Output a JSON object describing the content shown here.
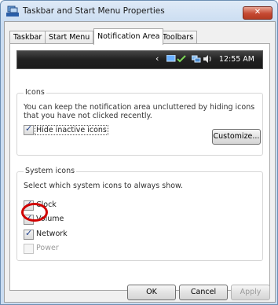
{
  "window": {
    "title": "Taskbar and Start Menu Properties",
    "close_label": "✕"
  },
  "tabs": [
    {
      "label": "Taskbar"
    },
    {
      "label": "Start Menu"
    },
    {
      "label": "Notification Area",
      "active": true
    },
    {
      "label": "Toolbars"
    }
  ],
  "taskbar_preview": {
    "chevron": "‹",
    "time": "12:55 AM"
  },
  "icons_group": {
    "title": "Icons",
    "description": "You can keep the notification area uncluttered by hiding icons that you have not clicked recently.",
    "hide_inactive_label": "Hide inactive icons",
    "hide_inactive_checked": true,
    "customize_label": "Customize..."
  },
  "system_icons_group": {
    "title": "System icons",
    "description": "Select which system icons to always show.",
    "items": [
      {
        "label": "Clock",
        "checked": true,
        "enabled": true
      },
      {
        "label": "Volume",
        "checked": true,
        "enabled": true
      },
      {
        "label": "Network",
        "checked": true,
        "enabled": true
      },
      {
        "label": "Power",
        "checked": false,
        "enabled": false
      }
    ]
  },
  "buttons": {
    "ok": "OK",
    "cancel": "Cancel",
    "apply": "Apply"
  },
  "colors": {
    "highlight_circle": "#d10000"
  }
}
